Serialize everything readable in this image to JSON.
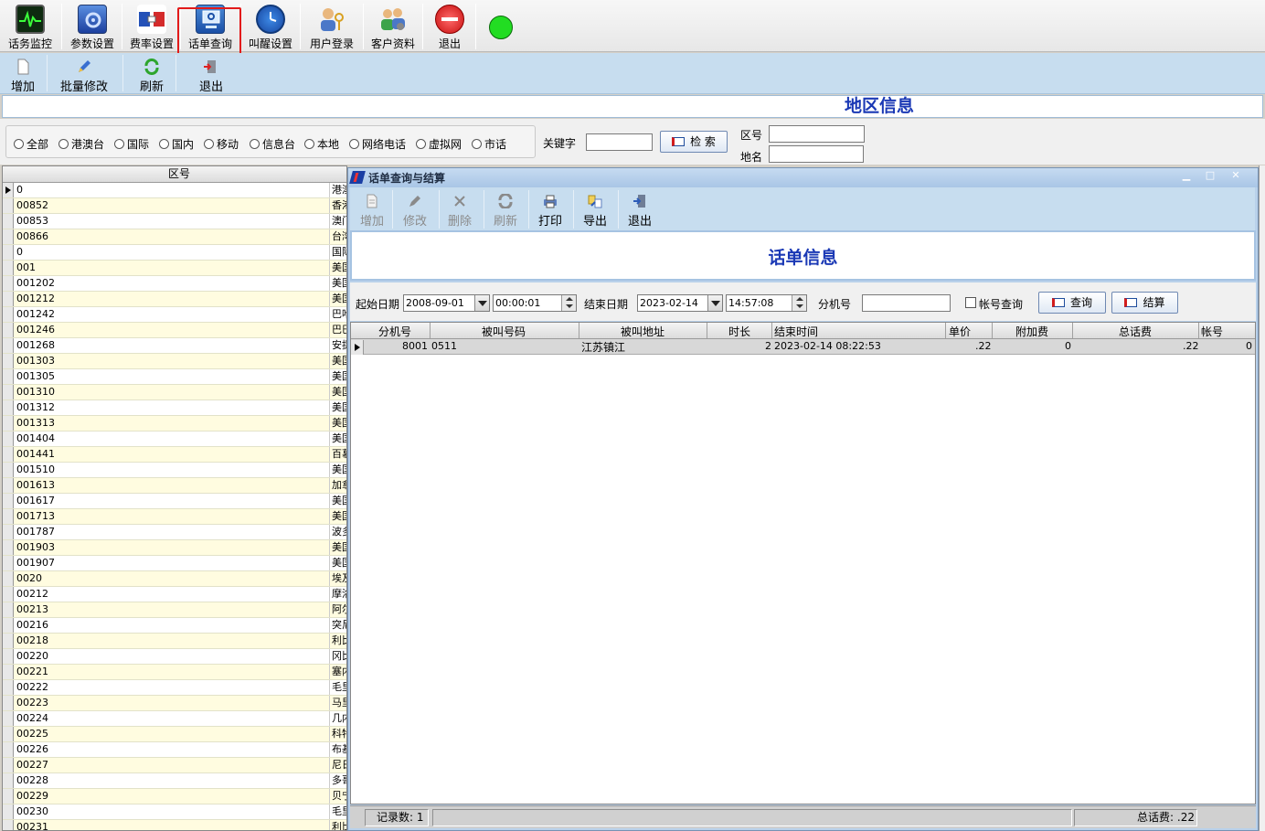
{
  "main_toolbar": {
    "items": [
      {
        "label": "话务监控",
        "icon": "monitor-icon"
      },
      {
        "label": "参数设置",
        "icon": "settings-icon"
      },
      {
        "label": "费率设置",
        "icon": "rate-icon"
      },
      {
        "label": "话单查询",
        "icon": "query-icon"
      },
      {
        "label": "叫醒设置",
        "icon": "clock-icon"
      },
      {
        "label": "用户登录",
        "icon": "user-key-icon"
      },
      {
        "label": "客户资料",
        "icon": "customers-icon"
      },
      {
        "label": "退出",
        "icon": "exit-icon"
      }
    ],
    "status_color": "#22dd22"
  },
  "sub_toolbar": {
    "add": "增加",
    "batch_edit": "批量修改",
    "refresh": "刷新",
    "exit": "退出"
  },
  "region_title": "地区信息",
  "filters": {
    "radios": [
      "全部",
      "港澳台",
      "国际",
      "国内",
      "移动",
      "信息台",
      "本地",
      "网络电话",
      "虚拟网",
      "市话"
    ],
    "keyword_label": "关键字",
    "search_button": "检 索",
    "area_code_label": "区号",
    "area_name_label": "地名"
  },
  "left_grid": {
    "header": "区号",
    "rows": [
      {
        "code": "0",
        "name": "港澳"
      },
      {
        "code": "00852",
        "name": "香港"
      },
      {
        "code": "00853",
        "name": "澳门"
      },
      {
        "code": "00866",
        "name": "台湾"
      },
      {
        "code": "0",
        "name": "国际"
      },
      {
        "code": "001",
        "name": "美国"
      },
      {
        "code": "001202",
        "name": "美国"
      },
      {
        "code": "001212",
        "name": "美国"
      },
      {
        "code": "001242",
        "name": "巴哈"
      },
      {
        "code": "001246",
        "name": "巴巴"
      },
      {
        "code": "001268",
        "name": "安提"
      },
      {
        "code": "001303",
        "name": "美国"
      },
      {
        "code": "001305",
        "name": "美国"
      },
      {
        "code": "001310",
        "name": "美国"
      },
      {
        "code": "001312",
        "name": "美国"
      },
      {
        "code": "001313",
        "name": "美国"
      },
      {
        "code": "001404",
        "name": "美国"
      },
      {
        "code": "001441",
        "name": "百慕"
      },
      {
        "code": "001510",
        "name": "美国"
      },
      {
        "code": "001613",
        "name": "加拿"
      },
      {
        "code": "001617",
        "name": "美国"
      },
      {
        "code": "001713",
        "name": "美国"
      },
      {
        "code": "001787",
        "name": "波多"
      },
      {
        "code": "001903",
        "name": "美国"
      },
      {
        "code": "001907",
        "name": "美国"
      },
      {
        "code": "0020",
        "name": "埃及"
      },
      {
        "code": "00212",
        "name": "摩洛"
      },
      {
        "code": "00213",
        "name": "阿尔"
      },
      {
        "code": "00216",
        "name": "突尼"
      },
      {
        "code": "00218",
        "name": "利比"
      },
      {
        "code": "00220",
        "name": "冈比"
      },
      {
        "code": "00221",
        "name": "塞内"
      },
      {
        "code": "00222",
        "name": "毛里"
      },
      {
        "code": "00223",
        "name": "马里"
      },
      {
        "code": "00224",
        "name": "几内"
      },
      {
        "code": "00225",
        "name": "科特"
      },
      {
        "code": "00226",
        "name": "布基"
      },
      {
        "code": "00227",
        "name": "尼日"
      },
      {
        "code": "00228",
        "name": "多哥"
      },
      {
        "code": "00229",
        "name": "贝宁"
      },
      {
        "code": "00230",
        "name": "毛里"
      },
      {
        "code": "00231",
        "name": "利比"
      }
    ]
  },
  "dialog": {
    "title": "话单查询与结算",
    "toolbar": {
      "add": "增加",
      "edit": "修改",
      "delete": "删除",
      "refresh": "刷新",
      "print": "打印",
      "export": "导出",
      "exit": "退出"
    },
    "bill_title": "话单信息",
    "filter": {
      "start_date_label": "起始日期",
      "start_date": "2008-09-01",
      "start_time": "00:00:01",
      "end_date_label": "结束日期",
      "end_date": "2023-02-14",
      "end_time": "14:57:08",
      "ext_label": "分机号",
      "account_query_label": "帐号查询",
      "query_button": "查询",
      "settle_button": "结算"
    },
    "grid": {
      "columns": [
        "分机号",
        "被叫号码",
        "被叫地址",
        "时长",
        "结束时间",
        "单价",
        "附加费",
        "总话费",
        "帐号"
      ],
      "rows": [
        {
          "ext": "8001",
          "called": "0511",
          "address": "江苏镇江",
          "duration": "2",
          "end_time": "2023-02-14 08:22:53",
          "price": ".22",
          "surcharge": "0",
          "total": ".22",
          "account": "0"
        }
      ]
    },
    "status": {
      "records": "记录数: 1",
      "total_fee": "总话费: .22"
    }
  }
}
